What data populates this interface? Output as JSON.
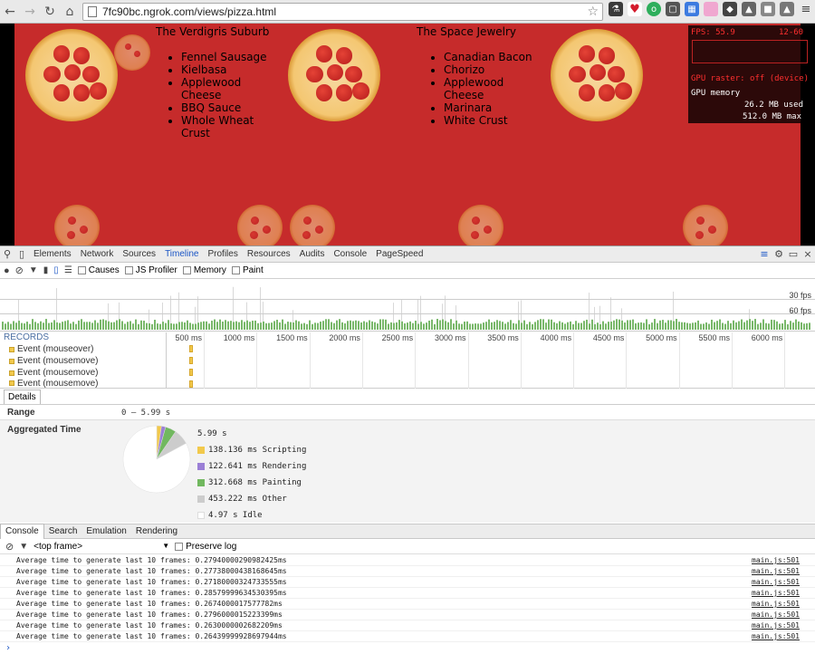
{
  "browser": {
    "url": "7fc90bc.ngrok.com/views/pizza.html",
    "nav_icons": [
      "back-icon",
      "forward-icon",
      "reload-icon",
      "home-icon"
    ]
  },
  "page": {
    "pizzas": [
      {
        "name": "The Verdigris Suburb",
        "ingredients": [
          "Fennel Sausage",
          "Kielbasa",
          "Applewood Cheese",
          "BBQ Sauce",
          "Whole Wheat Crust"
        ]
      },
      {
        "name": "The Space Jewelry",
        "ingredients": [
          "Canadian Bacon",
          "Chorizo",
          "Applewood Cheese",
          "Marinara",
          "White Crust"
        ]
      }
    ]
  },
  "fps_meter": {
    "fps": "FPS: 55.9",
    "range": "12-60",
    "gpu_raster": "GPU raster: off (device)",
    "gpu_memory_label": "GPU memory",
    "used": "26.2 MB used",
    "max": "512.0 MB max"
  },
  "devtools": {
    "tabs": [
      "Elements",
      "Network",
      "Sources",
      "Timeline",
      "Profiles",
      "Resources",
      "Audits",
      "Console",
      "PageSpeed"
    ],
    "active_tab": "Timeline",
    "timeline_options": [
      "Causes",
      "JS Profiler",
      "Memory",
      "Paint"
    ],
    "fps_labels": {
      "f30": "30 fps",
      "f60": "60 fps"
    },
    "records_header": "RECORDS",
    "records": [
      "Event (mouseover)",
      "Event (mousemove)",
      "Event (mousemove)",
      "Event (mousemove)"
    ],
    "ruler_ticks": [
      "500 ms",
      "1000 ms",
      "1500 ms",
      "2000 ms",
      "2500 ms",
      "3000 ms",
      "3500 ms",
      "4000 ms",
      "4500 ms",
      "5000 ms",
      "5500 ms",
      "6000 ms"
    ],
    "details_tab": "Details",
    "range_label": "Range",
    "range_value": "0 – 5.99 s",
    "aggregated_label": "Aggregated Time",
    "total": "5.99 s",
    "breakdown": [
      {
        "label": "138.136 ms Scripting",
        "color": "#f2c94c",
        "value_ms": 138.136
      },
      {
        "label": "122.641 ms Rendering",
        "color": "#9b7fd6",
        "value_ms": 122.641
      },
      {
        "label": "312.668 ms Painting",
        "color": "#71b85f",
        "value_ms": 312.668
      },
      {
        "label": "453.222 ms Other",
        "color": "#cccccc",
        "value_ms": 453.222
      },
      {
        "label": "4.97 s Idle",
        "color": "#ffffff",
        "value_ms": 4970
      }
    ],
    "console_tabs": [
      "Console",
      "Search",
      "Emulation",
      "Rendering"
    ],
    "console_frame": "<top frame>",
    "preserve_log": "Preserve log",
    "console_lines": [
      {
        "msg": "Average time to generate last 10 frames: 0.27940000290982425ms",
        "src": "main.js:501"
      },
      {
        "msg": "Average time to generate last 10 frames: 0.27738000438168645ms",
        "src": "main.js:501"
      },
      {
        "msg": "Average time to generate last 10 frames: 0.27180000324733555ms",
        "src": "main.js:501"
      },
      {
        "msg": "Average time to generate last 10 frames: 0.28579999634530395ms",
        "src": "main.js:501"
      },
      {
        "msg": "Average time to generate last 10 frames: 0.2674000017577782ms",
        "src": "main.js:501"
      },
      {
        "msg": "Average time to generate last 10 frames: 0.2796000015223399ms",
        "src": "main.js:501"
      },
      {
        "msg": "Average time to generate last 10 frames: 0.2630000002682209ms",
        "src": "main.js:501"
      },
      {
        "msg": "Average time to generate last 10 frames: 0.26439999928697944ms",
        "src": "main.js:501"
      }
    ]
  }
}
